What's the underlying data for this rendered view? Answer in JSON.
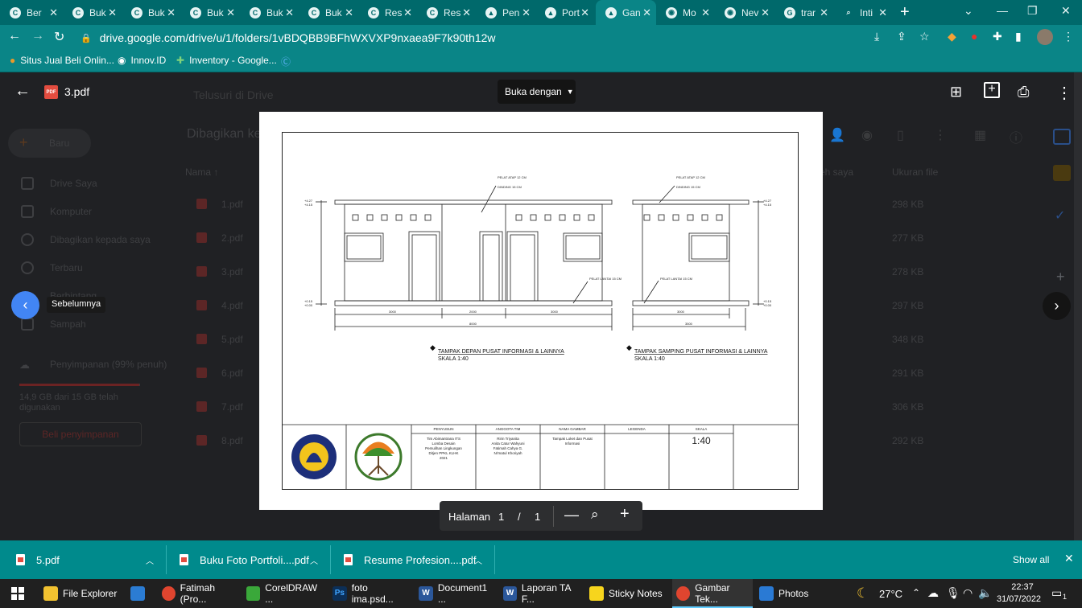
{
  "browser": {
    "tabs": [
      {
        "label": "Ber"
      },
      {
        "label": "Buk"
      },
      {
        "label": "Buk"
      },
      {
        "label": "Buk"
      },
      {
        "label": "Buk"
      },
      {
        "label": "Buk"
      },
      {
        "label": "Res"
      },
      {
        "label": "Res"
      },
      {
        "label": "Pen"
      },
      {
        "label": "Port"
      },
      {
        "label": "Gan"
      },
      {
        "label": "Mo"
      },
      {
        "label": "Nev"
      },
      {
        "label": "trar"
      },
      {
        "label": "Inti"
      }
    ],
    "url": "drive.google.com/drive/u/1/folders/1vBDQBB9BFhWXVXP9nxaea9F7k90th12w",
    "bookmarks": [
      "Situs Jual Beli Onlin...",
      "Innov.ID",
      "Inventory - Google..."
    ]
  },
  "drive": {
    "search_placeholder": "Telusuri di Drive",
    "new_button": "Baru",
    "shared_heading": "Dibagikan ke",
    "sidebar": [
      "Drive Saya",
      "Komputer",
      "Dibagikan kepada saya",
      "Terbaru",
      "Berbintang",
      "Sampah"
    ],
    "storage_label": "Penyimpanan (99% penuh)",
    "storage_detail": "14,9 GB dari 15 GB telah digunakan",
    "storage_fraction": 0.99,
    "buy_storage": "Beli penyimpanan",
    "col_name": "Nama",
    "col_owner": "eh saya",
    "col_size": "Ukuran file",
    "files": [
      {
        "name": "1.pdf",
        "size": "298 KB"
      },
      {
        "name": "2.pdf",
        "size": "277 KB"
      },
      {
        "name": "3.pdf",
        "size": "278 KB"
      },
      {
        "name": "4.pdf",
        "size": "297 KB"
      },
      {
        "name": "5.pdf",
        "size": "348 KB"
      },
      {
        "name": "6.pdf",
        "size": "291 KB"
      },
      {
        "name": "7.pdf",
        "size": "306 KB"
      },
      {
        "name": "8.pdf",
        "size": "292 KB"
      }
    ]
  },
  "viewer": {
    "filename": "3.pdf",
    "open_with": "Buka dengan",
    "prev_tooltip": "Sebelumnya",
    "page_label": "Halaman",
    "page_current": "1",
    "page_sep": "/",
    "page_total": "1"
  },
  "drawing": {
    "front_title": "TAMPAK DEPAN PUSAT INFORMASI & LAINNYA",
    "front_scale": "SKALA 1:40",
    "side_title": "TAMPAK SAMPING PUSAT INFORMASI & LAINNYA",
    "side_scale": "SKALA 1:40",
    "note_roof": "PELAT ATAP 12 CM",
    "note_wall": "DINDING 15 CM",
    "note_floor": "PELAT LANTAI 15 CM",
    "lv_top1": "+4.27",
    "lv_top2": "+4.15",
    "lv_bot1": "+0.15",
    "lv_bot2": "+0.00",
    "dim_front": [
      "3000",
      "2000",
      "3000"
    ],
    "dim_front_total": "8000",
    "dim_side": "3000",
    "dim_side_total": "3500",
    "titleblock": {
      "penyusun_h": "PENYUSUN",
      "penyusun": [
        "Tim Abimantrana ITS",
        "Lomba Desain",
        "Pemulihan Lingkungan",
        "Ditjen PPKL KLHK",
        "2021"
      ],
      "anggota_h": "ANGGOTA TIM",
      "anggota": [
        "Ririn Triyanita",
        "Anita Catur Wahyuni",
        "Fatimah Cahya G.",
        "Ni'matul Khoriyah"
      ],
      "gambar_h": "NAMA GAMBAR",
      "gambar": [
        "Tampak Loket dan Pusat",
        "Informasi"
      ],
      "legenda_h": "LEGENDA",
      "skala_h": "SKALA",
      "skala": "1:40"
    }
  },
  "downloads": {
    "items": [
      "5.pdf",
      "Buku Foto Portfoli....pdf",
      "Resume Profesion....pdf"
    ],
    "show_all": "Show all"
  },
  "taskbar": {
    "items": [
      "File Explorer",
      "Fatimah (Pro...",
      "CorelDRAW ...",
      "foto ima.psd...",
      "Document1 ...",
      "Laporan TA F...",
      "Sticky Notes",
      "Gambar Tek...",
      "Photos"
    ],
    "temperature": "27°C",
    "time": "22:37",
    "date": "31/07/2022",
    "notif_count": "1"
  },
  "colors": {
    "accent": "#00696b",
    "toolbar": "#0a8587",
    "downloads": "#008a8c",
    "blue": "#1a73e8"
  }
}
